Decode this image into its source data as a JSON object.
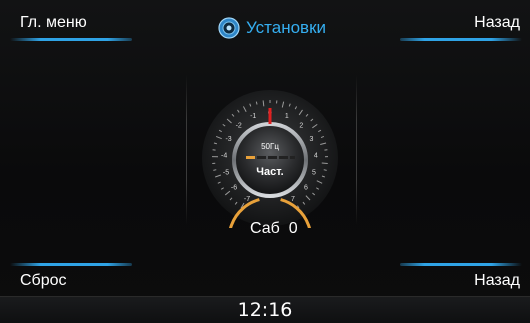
{
  "header": {
    "title": "Установки",
    "main_menu_label": "Гл. меню",
    "back_label": "Назад"
  },
  "footer": {
    "reset_label": "Сброс",
    "back_label": "Назад"
  },
  "knob": {
    "frequency": "50Гц",
    "mode_label": "Част.",
    "scale": [
      "-7",
      "-6",
      "-5",
      "-4",
      "-3",
      "-2",
      "-1",
      "0",
      "1",
      "2",
      "3",
      "4",
      "5",
      "6",
      "7"
    ],
    "value": 0
  },
  "subwoofer": {
    "label": "Саб",
    "value": "0"
  },
  "status": {
    "time": "12:16"
  },
  "colors": {
    "accent": "#2fa3e6",
    "arc": "#e8a13a",
    "needle": "#e02020"
  },
  "icons": {
    "title": "speaker-icon"
  }
}
